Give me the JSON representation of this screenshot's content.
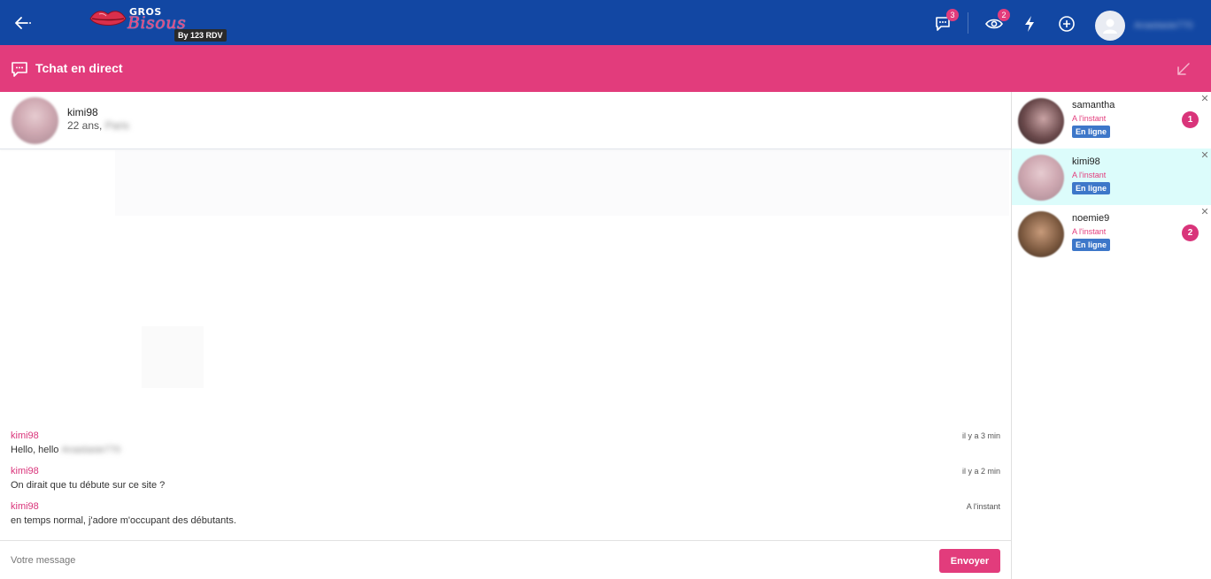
{
  "topbar": {
    "logo_top": "GROS",
    "logo_main": "Bisous",
    "logo_sub": "By 123 RDV",
    "messages_badge": "3",
    "views_badge": "2",
    "user_name": "Anastasie770"
  },
  "chat": {
    "title": "Tchat en direct"
  },
  "conversation": {
    "name": "kimi98",
    "age": "22 ans, ",
    "city": "Paris",
    "messages": [
      {
        "author": "kimi98",
        "time": "il y a 3 min",
        "text": "Hello, hello ",
        "blurred_name": "Anastasie770"
      },
      {
        "author": "kimi98",
        "time": "il y a 2 min",
        "text": "On dirait que tu débute sur ce site ?"
      },
      {
        "author": "kimi98",
        "time": "A l'instant",
        "text": "en temps normal, j'adore m'occupant des débutants."
      }
    ]
  },
  "composer": {
    "placeholder": "Votre message",
    "send_label": "Envoyer"
  },
  "contacts": [
    {
      "name": "samantha",
      "time": "A l'instant",
      "status": "En ligne",
      "badge": "1"
    },
    {
      "name": "kimi98",
      "time": "A l'instant",
      "status": "En ligne",
      "badge": ""
    },
    {
      "name": "noemie9",
      "time": "A l'instant",
      "status": "En ligne",
      "badge": "2"
    }
  ],
  "colors": {
    "topbar": "#1247a3",
    "accent": "#e23c7c",
    "status": "#3d77c9",
    "active_contact": "#dcfcfb"
  }
}
